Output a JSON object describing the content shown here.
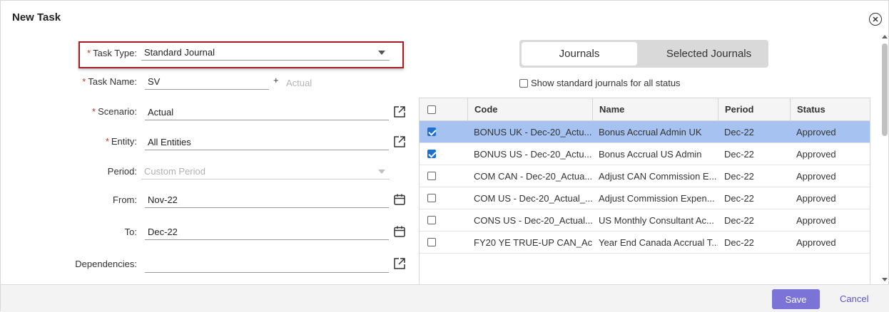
{
  "dialog": {
    "title": "New Task",
    "close_icon": "close-circle-icon"
  },
  "form": {
    "task_type": {
      "label": "Task Type:",
      "value": "Standard Journal",
      "required": true
    },
    "task_name": {
      "label": "Task Name:",
      "value": "SV",
      "required": true,
      "suffix_plus": "+",
      "suffix_text": "Actual"
    },
    "scenario": {
      "label": "Scenario:",
      "value": "Actual",
      "required": true,
      "icon": "external-link-icon"
    },
    "entity": {
      "label": "Entity:",
      "value": "All Entities",
      "required": true,
      "icon": "external-link-icon"
    },
    "period": {
      "label": "Period:",
      "placeholder": "Custom Period",
      "disabled": true
    },
    "from": {
      "label": "From:",
      "value": "Nov-22",
      "icon": "calendar-icon"
    },
    "to": {
      "label": "To:",
      "value": "Dec-22",
      "icon": "calendar-icon"
    },
    "dependencies": {
      "label": "Dependencies:",
      "value": "",
      "icon": "external-link-icon"
    },
    "required_marker": "*"
  },
  "toggle": {
    "options": [
      "Journals",
      "Selected Journals"
    ],
    "active_index": 0
  },
  "show_all_status": {
    "label": "Show standard journals for all status",
    "checked": false
  },
  "grid": {
    "columns": [
      "Code",
      "Name",
      "Period",
      "Status"
    ],
    "rows": [
      {
        "checked": true,
        "selected": true,
        "code": "BONUS UK - Dec-20_Actu...",
        "name": "Bonus Accrual Admin UK",
        "period": "Dec-22",
        "status": "Approved"
      },
      {
        "checked": true,
        "selected": false,
        "code": "BONUS US - Dec-20_Actu...",
        "name": "Bonus Accrual US Admin",
        "period": "Dec-22",
        "status": "Approved"
      },
      {
        "checked": false,
        "selected": false,
        "code": "COM CAN - Dec-20_Actua...",
        "name": "Adjust CAN Commission E...",
        "period": "Dec-22",
        "status": "Approved"
      },
      {
        "checked": false,
        "selected": false,
        "code": "COM US - Dec-20_Actual_...",
        "name": "Adjust Commission Expen...",
        "period": "Dec-22",
        "status": "Approved"
      },
      {
        "checked": false,
        "selected": false,
        "code": "CONS US - Dec-20_Actual...",
        "name": "US Monthly Consultant Ac...",
        "period": "Dec-22",
        "status": "Approved"
      },
      {
        "checked": false,
        "selected": false,
        "code": "FY20 YE TRUE-UP CAN_Ac...",
        "name": "Year End Canada Accrual T...",
        "period": "Dec-22",
        "status": "Approved"
      }
    ]
  },
  "footer": {
    "save_label": "Save",
    "cancel_label": "Cancel"
  },
  "colors": {
    "accent": "#7b74d6",
    "required": "#c0392b",
    "selected_row": "#a6c2f0",
    "checkbox": "#1f6fd1",
    "highlight_border": "#a31d24"
  }
}
